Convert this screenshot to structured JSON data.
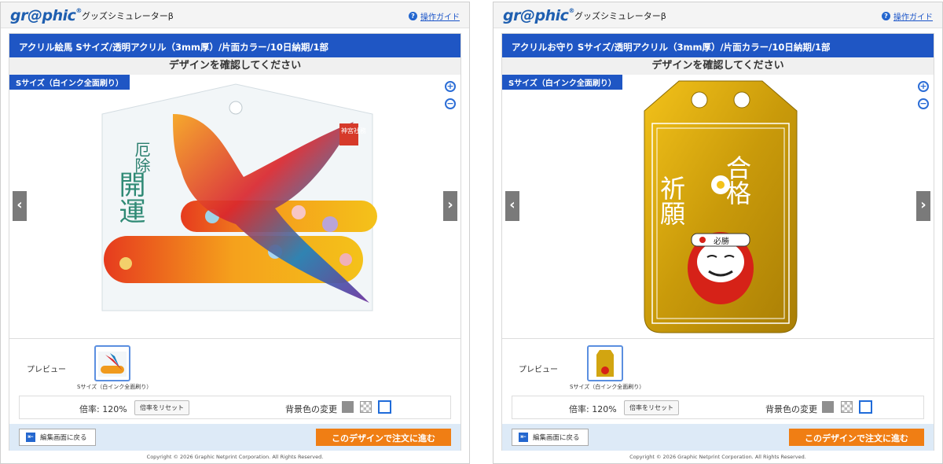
{
  "app": {
    "logo": "gr@phic",
    "subtitle": "グッズシミュレーターβ",
    "guide_label": "操作ガイド",
    "copyright": "Copyright © 2026 Graphic Netprint Corporation. All Rights Reserved."
  },
  "screens": [
    {
      "product_title": "アクリル絵馬 Sサイズ/透明アクリル（3mm厚）/片面カラー/10日納期/1部",
      "confirm_heading": "デザインを確認してください",
      "size_label": "Sサイズ（白インク全面刷り）",
      "art": {
        "text_top": "厄除",
        "text_main": "開運",
        "seal": "神宮社務"
      },
      "preview_label": "プレビュー",
      "thumb_caption": "Sサイズ（白インク全面刷り）",
      "zoom_rate": "倍率: 120%",
      "reset_label": "倍率をリセット",
      "bg_change_label": "背景色の変更",
      "back_label": "編集画面に戻る",
      "order_label": "このデザインで注文に進む"
    },
    {
      "product_title": "アクリルお守り Sサイズ/透明アクリル（3mm厚）/片面カラー/10日納期/1部",
      "confirm_heading": "デザインを確認してください",
      "size_label": "Sサイズ（白インク全面刷り）",
      "art": {
        "left_text": "祈願",
        "right_text": "合格",
        "daruma_text": "必勝"
      },
      "preview_label": "プレビュー",
      "thumb_caption": "Sサイズ（白インク全面刷り）",
      "zoom_rate": "倍率: 120%",
      "reset_label": "倍率をリセット",
      "bg_change_label": "背景色の変更",
      "back_label": "編集画面に戻る",
      "order_label": "このデザインで注文に進む"
    }
  ],
  "colors": {
    "brand_blue": "#1f56c4",
    "order_orange": "#f07e14",
    "footer_blue": "#ddeaf7"
  }
}
